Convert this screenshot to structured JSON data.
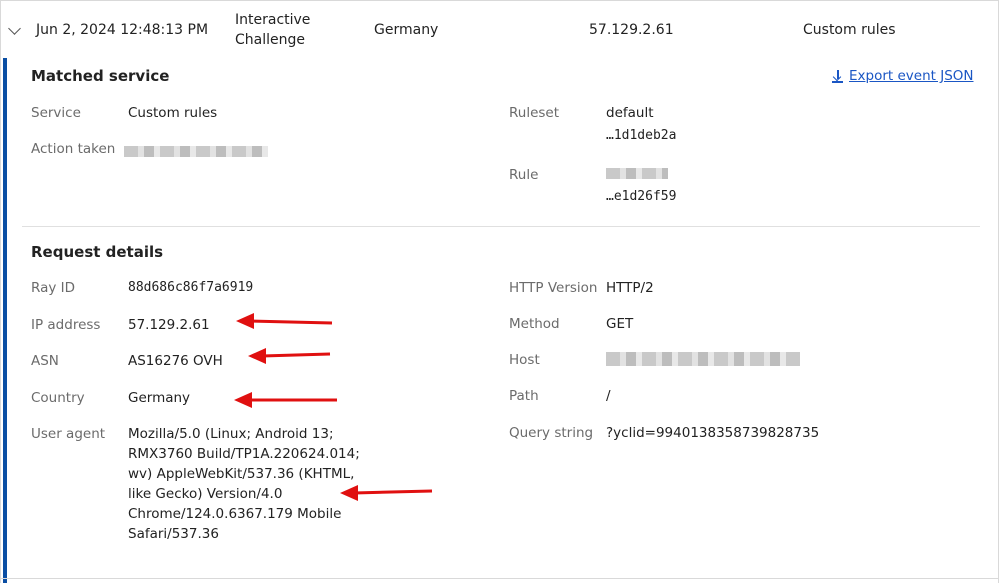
{
  "summary": {
    "datetime": "Jun 2, 2024 12:48:13 PM",
    "action_line1": "Interactive",
    "action_line2": "Challenge",
    "country": "Germany",
    "ip": "57.129.2.61",
    "service": "Custom rules"
  },
  "matched_service": {
    "title": "Matched service",
    "export_label": "Export event JSON",
    "service_label": "Service",
    "service_value": "Custom rules",
    "action_label": "Action taken",
    "ruleset_label": "Ruleset",
    "ruleset_name": "default",
    "ruleset_id": "…1d1deb2a",
    "rule_label": "Rule",
    "rule_id": "…e1d26f59"
  },
  "request_details": {
    "title": "Request details",
    "ray_label": "Ray ID",
    "ray_value": "88d686c86f7a6919",
    "ip_label": "IP address",
    "ip_value": "57.129.2.61",
    "asn_label": "ASN",
    "asn_value": "AS16276 OVH",
    "country_label": "Country",
    "country_value": "Germany",
    "ua_label": "User agent",
    "ua_value": "Mozilla/5.0 (Linux; Android 13; RMX3760 Build/TP1A.220624.014; wv) AppleWebKit/537.36 (KHTML, like Gecko) Version/4.0 Chrome/124.0.6367.179 Mobile Safari/537.36",
    "http_label": "HTTP Version",
    "http_value": "HTTP/2",
    "method_label": "Method",
    "method_value": "GET",
    "host_label": "Host",
    "path_label": "Path",
    "path_value": "/",
    "query_label": "Query string",
    "query_value": "?yclid=9940138358739828735"
  },
  "colors": {
    "accent": "#0a4ea3",
    "link": "#1a56c4",
    "annotation_arrow": "#e01010"
  }
}
